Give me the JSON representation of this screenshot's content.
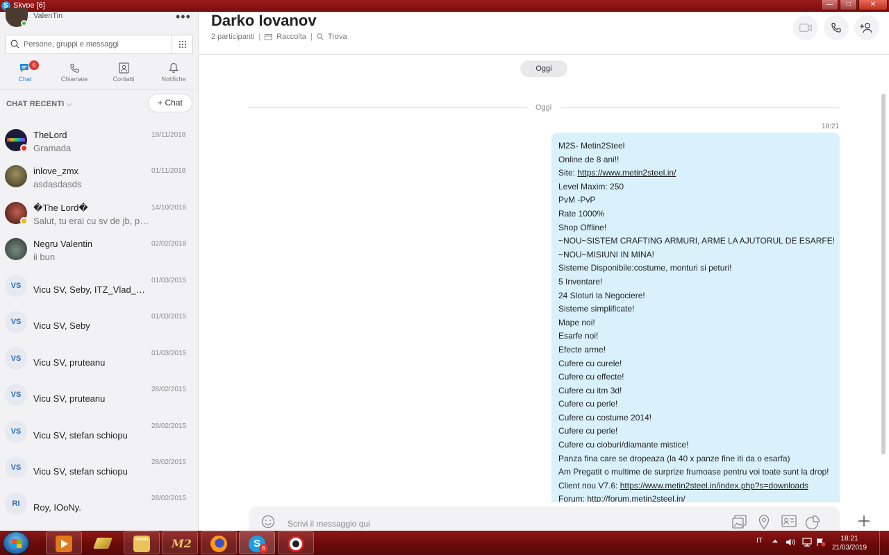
{
  "window": {
    "title": "Skype [6]",
    "app_icon": "S",
    "buttons": {
      "minimize": "—",
      "maximize": "□",
      "close": "✕"
    }
  },
  "profile": {
    "name": "ValenTin",
    "status_color": "#3cb93c",
    "more": "•••"
  },
  "search": {
    "placeholder": "Persone, gruppi e messaggi"
  },
  "nav": {
    "chat": {
      "label": "Chat",
      "badge": "6"
    },
    "calls": {
      "label": "Chiamate"
    },
    "contacts": {
      "label": "Contatti"
    },
    "notifications": {
      "label": "Notifiche"
    }
  },
  "recent": {
    "header": "CHAT RECENTI",
    "chevron": "⌵",
    "new_chat": "+  Chat"
  },
  "chats": [
    {
      "name": "TheLord",
      "preview": "Gramada",
      "date": "19/11/2018",
      "avatar": "image",
      "avatar_color": "#1b1b3a",
      "status": "red"
    },
    {
      "name": "inlove_zmx",
      "preview": "asdasdasds",
      "date": "01/11/2018",
      "avatar": "image",
      "avatar_color": "#5e5a3c"
    },
    {
      "name": "�The Lord�",
      "preview": "Salut, tu erai cu sv de jb, pa...",
      "date": "14/10/2018",
      "avatar": "image",
      "avatar_color": "#4a2020",
      "status": "yellow"
    },
    {
      "name": "Negru Valentin",
      "preview": "ii bun",
      "date": "02/02/2018",
      "avatar": "image",
      "avatar_color": "#3a4a40"
    },
    {
      "name": "Vicu SV, Seby, ITZ_Vlad_G...",
      "date": "01/03/2015",
      "avatar": "VS"
    },
    {
      "name": "Vicu SV, Seby",
      "date": "01/03/2015",
      "avatar": "VS"
    },
    {
      "name": "Vicu SV, pruteanu",
      "date": "01/03/2015",
      "avatar": "VS"
    },
    {
      "name": "Vicu SV, pruteanu",
      "date": "28/02/2015",
      "avatar": "VS"
    },
    {
      "name": "Vicu SV, stefan schiopu",
      "date": "28/02/2015",
      "avatar": "VS"
    },
    {
      "name": "Vicu SV, stefan schiopu",
      "date": "28/02/2015",
      "avatar": "VS"
    },
    {
      "name": "Roy, IOoNy.",
      "date": "28/02/2015",
      "avatar": "RI"
    }
  ],
  "conversation": {
    "title": "Darko Iovanov",
    "participants": "2 participanti",
    "gallery": "Raccolta",
    "find": "Trova",
    "day_pill": "Oggi",
    "day_separator": "Oggi",
    "message_time": "18:21",
    "message_lines": [
      "M2S- Metin2Steel",
      "Online de 8 ani!!",
      {
        "prefix": "Site: ",
        "link": "https://www.metin2steel.in/"
      },
      "Level Maxim: 250",
      "PvM -PvP",
      "Rate 1000%",
      "Shop Offline!",
      "~NOU~SISTEM CRAFTING ARMURI, ARME LA AJUTORUL DE ESARFE!",
      "~NOU~MISIUNI IN MINA!",
      "Sisteme Disponibile:costume, monturi si peturi!",
      "5 Inventare!",
      "24 Sloturi la Negociere!",
      "Sisteme simplificate!",
      "Mape noi!",
      "Esarfe noi!",
      "Efecte arme!",
      "Cufere cu curele!",
      "Cufere cu effecte!",
      "Cufere cu itm 3d!",
      "Cufere cu perle!",
      "Cufere cu costume 2014!",
      "Cufere cu perle!",
      "Cufere cu cioburi/diamante mistice!",
      "Panza fina care se dropeaza (la 40 x panze fine iti da o esarfa)",
      "Am Pregatit o multime de surprize frumoase pentru voi toate sunt la drop!",
      {
        "prefix": "Client nou V7.6: ",
        "link": "https://www.metin2steel.in/index.php?s=downloads"
      },
      "Forum: http://forum.metin2steel.in/"
    ],
    "composer_placeholder": "Scrivi il messaggio qui"
  },
  "taskbar": {
    "apps": [
      {
        "name": "media-player",
        "color": "#e07a1a"
      },
      {
        "name": "shortcut-arrow",
        "color": "#d8b84a"
      },
      {
        "name": "file-explorer",
        "color": "#e8c25a"
      },
      {
        "name": "metin2",
        "color": "#b58b2a",
        "label": "M2"
      },
      {
        "name": "firefox",
        "color": "#ff7b1a"
      },
      {
        "name": "skype",
        "color": "#1c9ee6",
        "badge": "6"
      },
      {
        "name": "recorder",
        "color": "#d32020"
      }
    ],
    "language": "IT",
    "time": "18:21",
    "date": "21/03/2019"
  },
  "colors": {
    "accent": "#1f8ad8",
    "bubble": "#d9f1fb",
    "taskbar": "#7a0c0c",
    "badge": "#e0342d"
  }
}
